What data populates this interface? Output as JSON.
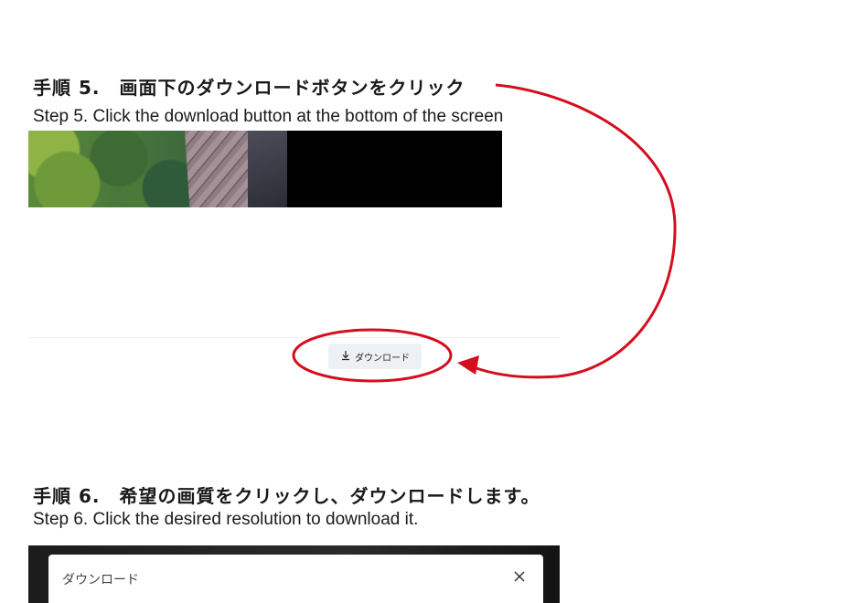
{
  "step5": {
    "heading_ja": "手順 5.　画面下のダウンロードボタンをクリック",
    "heading_en": "Step 5. Click the download button at the bottom of the screen"
  },
  "download_button": {
    "label": "ダウンロード",
    "icon": "download-icon"
  },
  "annotation": {
    "color": "#d40e1e",
    "shapes": [
      "circle-around-download-button",
      "curved-arrow"
    ]
  },
  "step6": {
    "heading_ja": "手順 6.　希望の画質をクリックし、ダウンロードします。",
    "heading_en": "Step 6. Click the desired resolution to download it."
  },
  "dialog": {
    "title": "ダウンロード",
    "close_icon": "close-icon"
  }
}
